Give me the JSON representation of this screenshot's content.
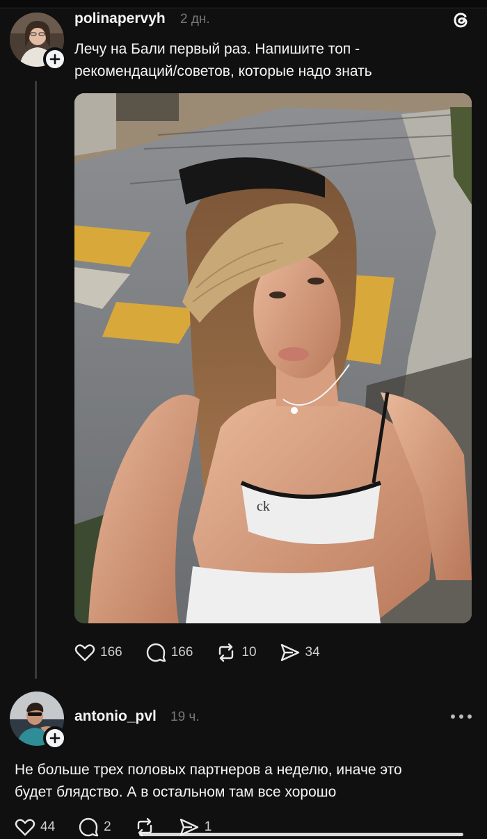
{
  "post": {
    "username": "polinapervyh",
    "time": "2 дн.",
    "text_line1": "Лечу на Бали первый раз. Напишите топ -",
    "text_line2": "рекомендаций/советов, которые надо знать",
    "likes": "166",
    "comments": "166",
    "reposts": "10",
    "shares": "34"
  },
  "reply": {
    "username": "antonio_pvl",
    "time": "19 ч.",
    "text_line1": "Не больше трех половых партнеров а неделю, иначе это",
    "text_line2": "будет блядство. А в остальном там все хорошо",
    "likes": "44",
    "comments": "2",
    "shares": "1"
  },
  "icons": {
    "app_logo": "threads-logo-icon",
    "like": "heart-icon",
    "comment": "speech-bubble-icon",
    "repost": "repost-icon",
    "share": "send-icon",
    "more": "more-dots-icon",
    "follow": "plus-icon"
  },
  "colors": {
    "background": "#101010",
    "text": "#f3f5f7",
    "muted": "#777777",
    "thread_line": "#3a3a3a"
  }
}
